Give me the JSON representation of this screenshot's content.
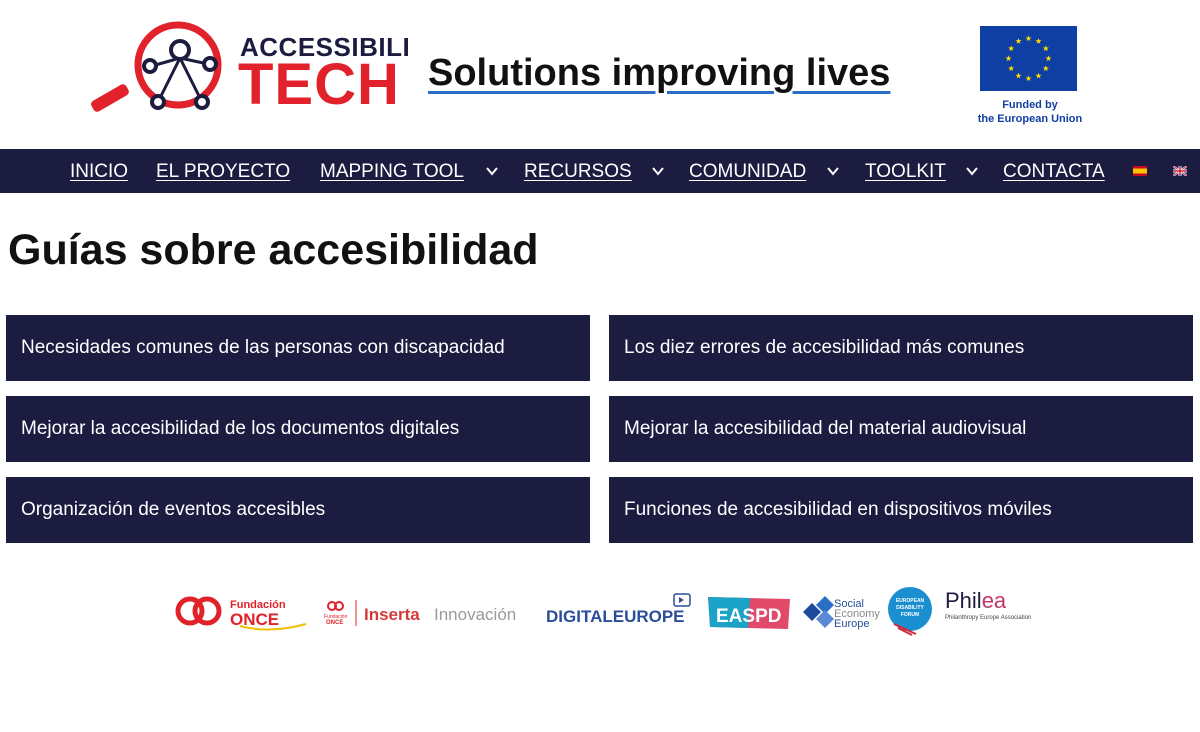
{
  "header": {
    "logo": {
      "line1": "ACCESSIBILI",
      "line2": "TECH"
    },
    "tagline": "Solutions improving lives",
    "eu": {
      "caption_line1": "Funded by",
      "caption_line2": "the European Union"
    }
  },
  "nav": {
    "items": [
      {
        "label": "INICIO",
        "dropdown": false
      },
      {
        "label": "EL PROYECTO",
        "dropdown": false
      },
      {
        "label": "MAPPING TOOL",
        "dropdown": true
      },
      {
        "label": "RECURSOS",
        "dropdown": true
      },
      {
        "label": "COMUNIDAD",
        "dropdown": true
      },
      {
        "label": "TOOLKIT",
        "dropdown": true
      },
      {
        "label": "CONTACTA",
        "dropdown": false
      }
    ],
    "languages": [
      "spanish-flag-icon",
      "uk-flag-icon"
    ]
  },
  "main": {
    "title": "Guías sobre accesibilidad",
    "cards": [
      "Necesidades comunes de las personas con discapacidad",
      "Los diez errores de accesibilidad más comunes",
      "Mejorar la accesibilidad de los documentos digitales",
      "Mejorar la accesibilidad del material audiovisual",
      "Organización de eventos accesibles",
      "Funciones de accesibilidad en dispositivos móviles"
    ]
  },
  "partners": {
    "fundacion": {
      "line1": "Fundación",
      "line2": "ONCE"
    },
    "inserta": {
      "prefix_line1": "Fundación",
      "prefix_line2": "ONCE",
      "word1": "Inserta",
      "word2": "Innovación"
    },
    "digitaleurope": "DIGITALEUROPE",
    "easpd": "EASPD",
    "social": {
      "line1": "Social",
      "line2": "Economy",
      "line3": "Europe"
    },
    "edf": {
      "line1": "EUROPEAN",
      "line2": "DISABILITY",
      "line3": "FORUM"
    },
    "philea": {
      "name": "Phil",
      "tail": "ea",
      "caption": "Philanthropy Europe Association"
    }
  },
  "colors": {
    "navy": "#1c1b40",
    "brand_red": "#e1222a",
    "eu_blue": "#0f3fa3",
    "eu_star": "#ffdd00",
    "tagline_underline": "#2a6ec6"
  }
}
